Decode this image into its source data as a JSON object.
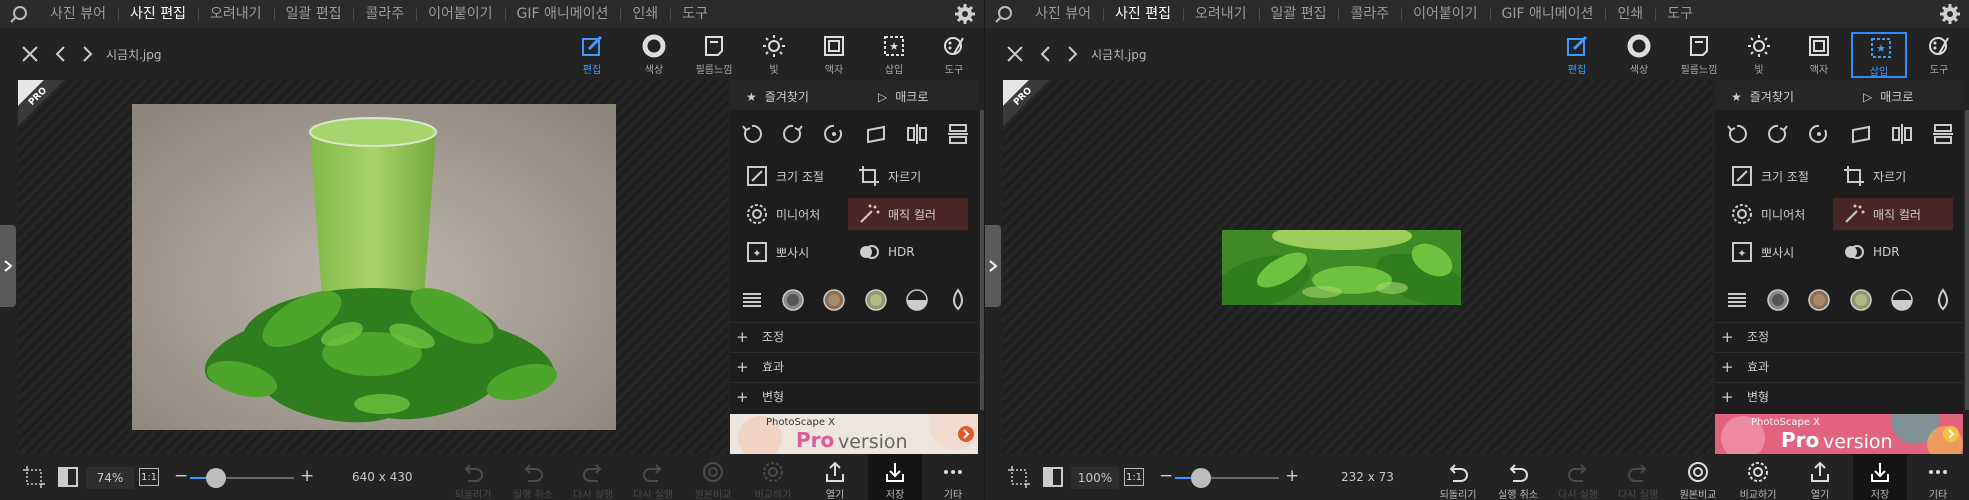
{
  "colors": {
    "accent": "#3d9bff",
    "selection": "#2f8cff",
    "magic_bg": "#4a2525",
    "badge_bg": "#e05a9a"
  },
  "menu": {
    "items": [
      "사진 뷰어",
      "사진 편집",
      "오려내기",
      "일괄 편집",
      "콜라주",
      "이어붙이기",
      "GIF 애니메이션",
      "인쇄",
      "도구"
    ],
    "active": "사진 편집"
  },
  "left": {
    "filename": "시금치.jpg",
    "tools": [
      {
        "label": "편집",
        "icon": "edit-icon"
      },
      {
        "label": "색상",
        "icon": "color-icon"
      },
      {
        "label": "필름느낌",
        "icon": "film-icon"
      },
      {
        "label": "빛",
        "icon": "light-icon"
      },
      {
        "label": "액자",
        "icon": "frame-icon"
      },
      {
        "label": "삽입",
        "icon": "insert-icon"
      },
      {
        "label": "도구",
        "icon": "tools-icon"
      }
    ],
    "panel": {
      "favorites": "즐겨찾기",
      "macro": "매크로",
      "features": [
        "크기 조절",
        "자르기",
        "미니어처",
        "매직 컬러",
        "뽀사시",
        "HDR"
      ],
      "accordion": [
        "조정",
        "효과",
        "변형"
      ]
    },
    "ad": {
      "brand": "PhotoScape X",
      "pro": "Pro",
      "version": "version"
    },
    "zoom": "74%",
    "one_to_one": "1:1",
    "zoom_level": 0.25,
    "dims": "640 x 430",
    "bottom_buttons": [
      "되돌리기",
      "실행 취소",
      "다시 실행",
      "다시 실행",
      "원본비교",
      "비교하기",
      "열기",
      "저장",
      "기타"
    ],
    "pro_badge": "PRO"
  },
  "right": {
    "filename": "시금치.jpg",
    "tools": [
      {
        "label": "편집",
        "icon": "edit-icon"
      },
      {
        "label": "색상",
        "icon": "color-icon"
      },
      {
        "label": "필름느낌",
        "icon": "film-icon"
      },
      {
        "label": "빛",
        "icon": "light-icon"
      },
      {
        "label": "액자",
        "icon": "frame-icon"
      },
      {
        "label": "삽입",
        "icon": "insert-icon"
      },
      {
        "label": "도구",
        "icon": "tools-icon"
      }
    ],
    "panel": {
      "favorites": "즐겨찾기",
      "macro": "매크로",
      "features": [
        "크기 조절",
        "자르기",
        "미니어처",
        "매직 컬러",
        "뽀사시",
        "HDR"
      ],
      "accordion": [
        "조정",
        "효과",
        "변형"
      ]
    },
    "ad": {
      "brand": "PhotoScape X",
      "pro": "Pro",
      "version": "version"
    },
    "zoom": "100%",
    "one_to_one": "1:1",
    "zoom_level": 0.25,
    "dims": "232 x 73",
    "bottom_buttons": [
      "되돌리기",
      "실행 취소",
      "다시 실행",
      "다시 실행",
      "원본비교",
      "비교하기",
      "열기",
      "저장",
      "기타"
    ],
    "pro_badge": "PRO"
  }
}
